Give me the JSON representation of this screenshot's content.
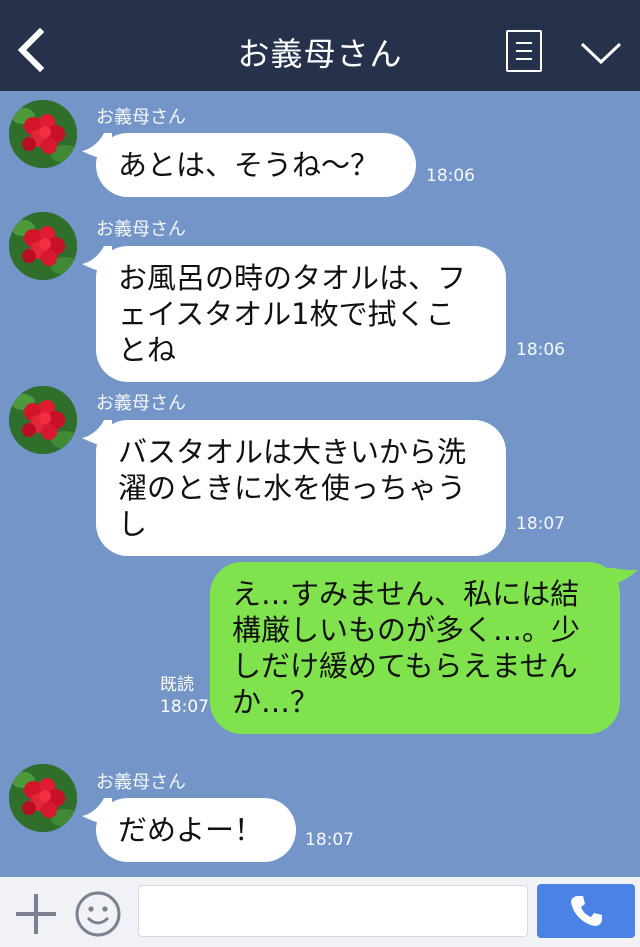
{
  "header": {
    "title": "お義母さん"
  },
  "messages": [
    {
      "sender": "お義母さん",
      "lines": [
        "あとは、そうね〜？"
      ],
      "time": "18:06"
    },
    {
      "sender": "お義母さん",
      "lines": [
        "お風呂の時のタオルは、フ",
        "ェイスタオル1枚で拭くこ",
        "とね"
      ],
      "time": "18:06"
    },
    {
      "sender": "お義母さん",
      "lines": [
        "バスタオルは大きいから洗",
        "濯のときに水を使っちゃう",
        "し"
      ],
      "time": "18:07"
    },
    {
      "lines": [
        "え…すみません、私には結",
        "構厳しいものが多く…。少",
        "しだけ緩めてもらえません",
        "か…？"
      ],
      "read": "既読",
      "time": "18:07"
    },
    {
      "sender": "お義母さん",
      "lines": [
        "だめよー！"
      ],
      "time": "18:07"
    }
  ],
  "footer": {
    "input_value": ""
  },
  "colors": {
    "header_bg": "#26324b",
    "chat_bg": "#7495c7",
    "incoming_bubble": "#ffffff",
    "outgoing_bubble": "#80e34d",
    "call_button": "#4b82e6"
  },
  "icons": [
    "back-chevron-icon",
    "menu-icon",
    "chevron-down-icon",
    "plus-icon",
    "smile-icon",
    "phone-icon"
  ]
}
